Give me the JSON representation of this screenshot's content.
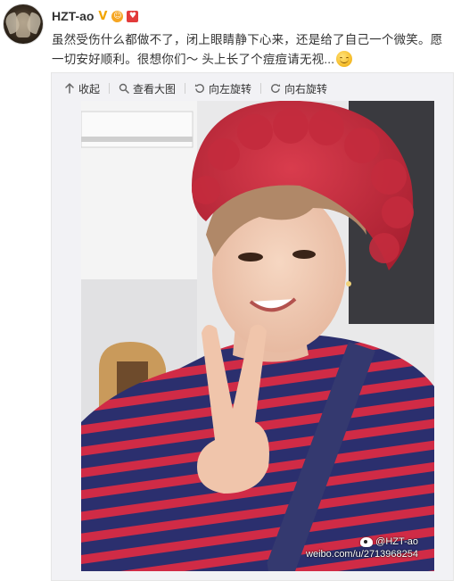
{
  "post": {
    "username": "HZT-ao",
    "badges": {
      "verified": "V",
      "vip": "☺",
      "level": "♥"
    },
    "text": "虽然受伤什么都做不了，闭上眼睛静下心来，还是给了自己一个微笑。愿一切安好顺利。很想你们～ 头上长了个痘痘请无视..."
  },
  "media": {
    "toolbar": {
      "collapse": "收起",
      "view_large": "查看大图",
      "rotate_left": "向左旋转",
      "rotate_right": "向右旋转"
    },
    "watermark": {
      "handle": "@HZT-ao",
      "url": "weibo.com/u/2713968254"
    }
  },
  "icons": {
    "collapse": "arrow-up-icon",
    "view_large": "magnifier-icon",
    "rotate_left": "rotate-left-icon",
    "rotate_right": "rotate-right-icon"
  },
  "colors": {
    "username": "#333333",
    "toolbar_bg": "#f2f2f5",
    "verified_badge": "#f2a500",
    "level_badge": "#e23b3b"
  }
}
